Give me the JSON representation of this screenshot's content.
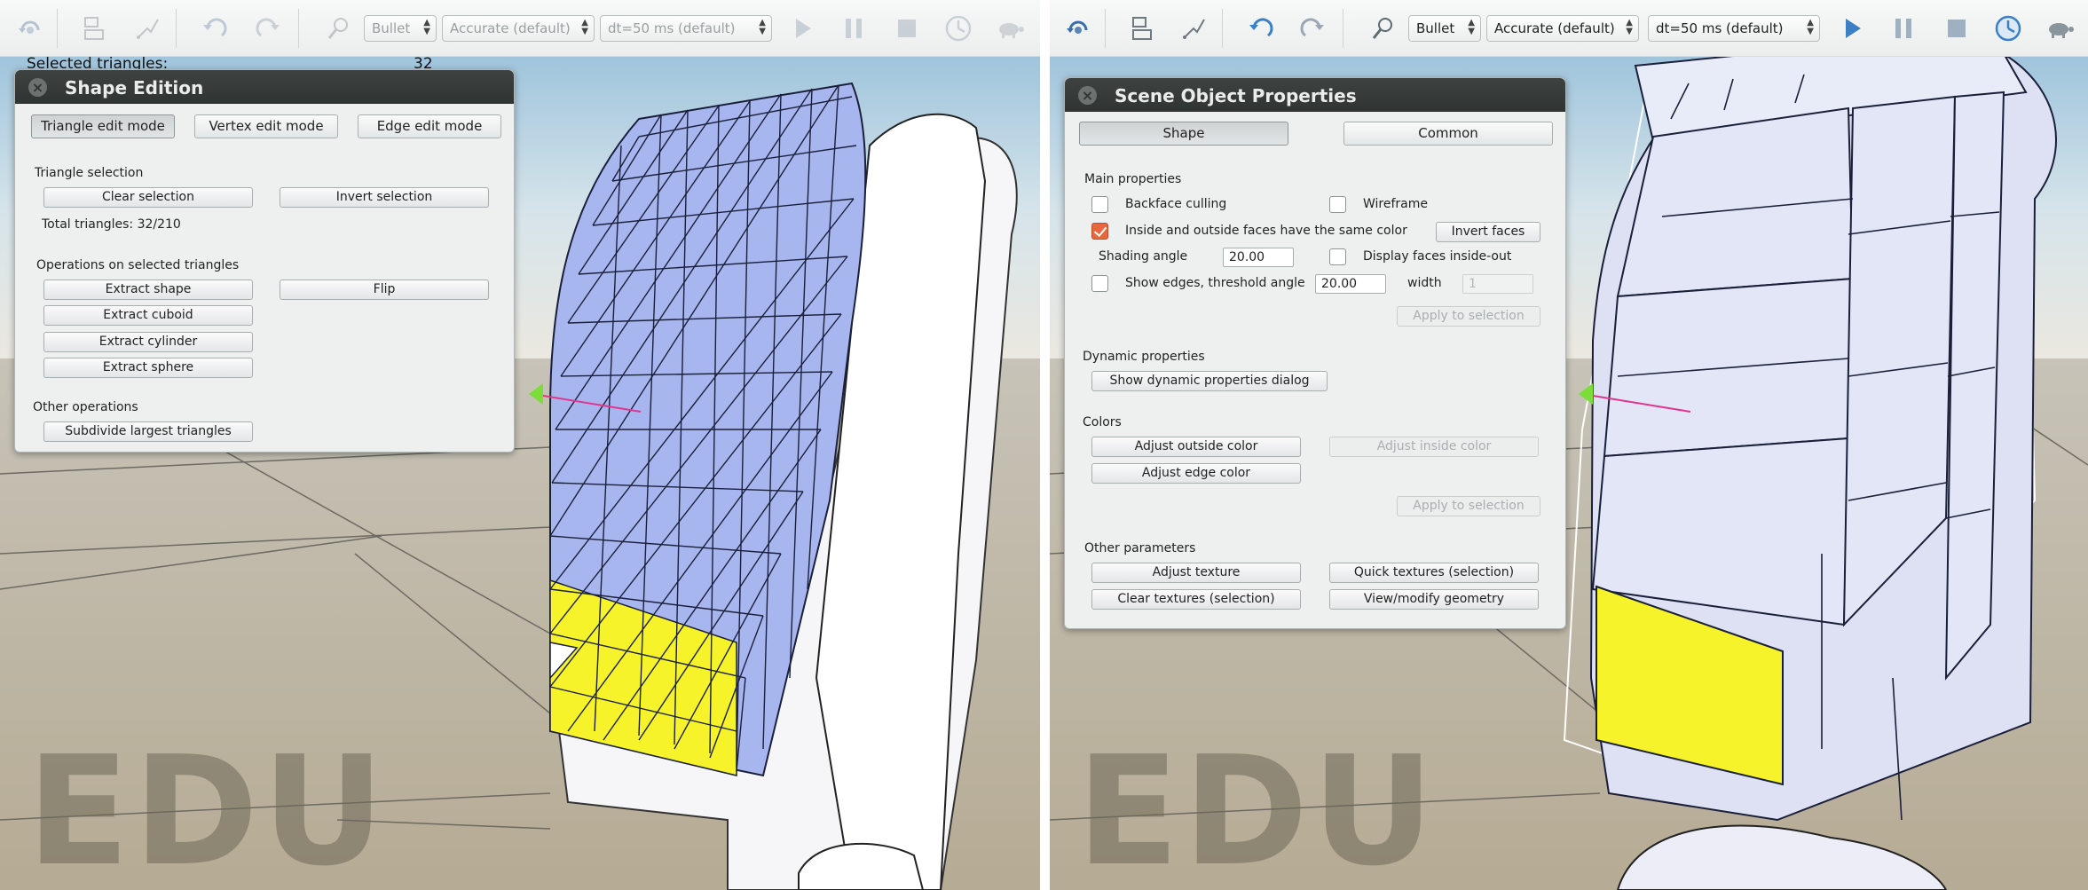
{
  "left_pane": {
    "toolbar": {
      "engine": "Bullet",
      "accuracy": "Accurate (default)",
      "timestep": "dt=50 ms (default)"
    },
    "overlay": {
      "label": "Selected triangles:",
      "value": "32"
    },
    "dialog": {
      "title": "Shape Edition",
      "modes": [
        "Triangle edit mode",
        "Vertex edit mode",
        "Edge edit mode"
      ],
      "triangle_selection": {
        "heading": "Triangle selection",
        "clear": "Clear selection",
        "invert": "Invert selection",
        "total": "Total triangles: 32/210"
      },
      "operations": {
        "heading": "Operations on selected triangles",
        "extract_shape": "Extract shape",
        "flip": "Flip",
        "extract_cuboid": "Extract cuboid",
        "extract_cylinder": "Extract cylinder",
        "extract_sphere": "Extract sphere"
      },
      "other": {
        "heading": "Other operations",
        "subdivide": "Subdivide largest triangles"
      }
    },
    "watermark": "EDU"
  },
  "right_pane": {
    "toolbar": {
      "engine": "Bullet",
      "accuracy": "Accurate (default)",
      "timestep": "dt=50 ms (default)"
    },
    "dialog": {
      "title": "Scene Object Properties",
      "tabs": [
        "Shape",
        "Common"
      ],
      "main": {
        "heading": "Main properties",
        "backface": {
          "label": "Backface culling",
          "checked": false
        },
        "wireframe": {
          "label": "Wireframe",
          "checked": false
        },
        "same_color": {
          "label": "Inside and outside faces have the same color",
          "checked": true
        },
        "invert_faces": "Invert faces",
        "shading_label": "Shading angle",
        "shading_value": "20.00",
        "inside_out": {
          "label": "Display faces inside-out",
          "checked": false
        },
        "show_edges": {
          "label": "Show edges, threshold angle",
          "checked": false
        },
        "threshold_value": "20.00",
        "width_label": "width",
        "width_value": "1",
        "apply": "Apply to selection"
      },
      "dynamic": {
        "heading": "Dynamic properties",
        "show_dialog": "Show dynamic properties dialog"
      },
      "colors": {
        "heading": "Colors",
        "outside": "Adjust outside color",
        "inside": "Adjust inside color",
        "edge": "Adjust edge color",
        "apply": "Apply to selection"
      },
      "other": {
        "heading": "Other parameters",
        "adjust_texture": "Adjust texture",
        "quick_textures": "Quick textures (selection)",
        "clear_textures": "Clear textures (selection)",
        "view_geometry": "View/modify geometry"
      }
    },
    "watermark": "EDU"
  },
  "colors": {
    "accent_orange": "#e9673f",
    "selection_yellow": "#f6f32a",
    "mesh_blue": "#a8b6ef",
    "titlebar_dark": "#353a39",
    "toolbar_blue_icon": "#3b7fc4"
  }
}
